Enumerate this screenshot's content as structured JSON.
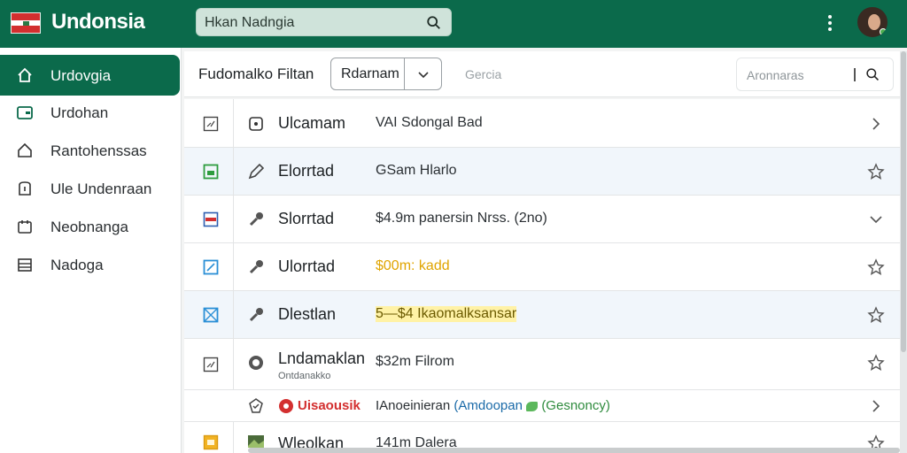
{
  "header": {
    "brand": "Undonsia",
    "search_value": "Hkan Nadngia",
    "colors": {
      "brand_green": "#0b6a4b",
      "flag_red": "#d32f2f"
    }
  },
  "sidebar": {
    "items": [
      {
        "label": "Urdovgia",
        "icon": "home-icon",
        "active": true
      },
      {
        "label": "Urdohan",
        "icon": "wallet-icon",
        "active": false
      },
      {
        "label": "Rantohenssas",
        "icon": "house-icon",
        "active": false
      },
      {
        "label": "Ule Undenraan",
        "icon": "info-icon",
        "active": false
      },
      {
        "label": "Neobnanga",
        "icon": "calendar-icon",
        "active": false
      },
      {
        "label": "Nadoga",
        "icon": "table-icon",
        "active": false
      }
    ]
  },
  "toolbar": {
    "title": "Fudomalko Filtan",
    "dropdown_value": "Rdarnam",
    "placeholder": "Gercia",
    "search_value": "Aronnaras"
  },
  "rows": [
    {
      "name": "Ulcamam",
      "sub": "",
      "desc": "VAI Sdongal Bad",
      "desc_style": "plain",
      "right_icon": "chevron-right-icon"
    },
    {
      "name": "Elorrtad",
      "sub": "",
      "desc": "GSam Hlarlo",
      "desc_style": "plain",
      "right_icon": "star-icon"
    },
    {
      "name": "Slorrtad",
      "sub": "",
      "desc": "$4.9m panersin Nrss. (2no)",
      "desc_style": "plain",
      "right_icon": "chevron-down-icon"
    },
    {
      "name": "Ulorrtad",
      "sub": "",
      "desc": "$00m: kadd",
      "desc_style": "gold",
      "right_icon": "star-icon"
    },
    {
      "name": "Dlestlan",
      "sub": "",
      "desc": "5—$4 Ikaomalksansar",
      "desc_style": "highlight",
      "right_icon": "star-icon"
    },
    {
      "name": "Lndamaklan",
      "sub": "Ontdanakko",
      "desc": "$32m Filrom",
      "desc_style": "plain",
      "right_icon": "star-icon"
    },
    {
      "name": "Uisaousik",
      "sub": "",
      "desc": "IAnoeinieran",
      "tag1": "(Amdoopan",
      "tag2": "(Gesnoncy)",
      "desc_style": "tags",
      "right_icon": "chevron-right-icon"
    },
    {
      "name": "Wleolkan",
      "sub": "",
      "desc": "141m Dalera",
      "desc_style": "plain",
      "right_icon": "star-icon"
    }
  ]
}
